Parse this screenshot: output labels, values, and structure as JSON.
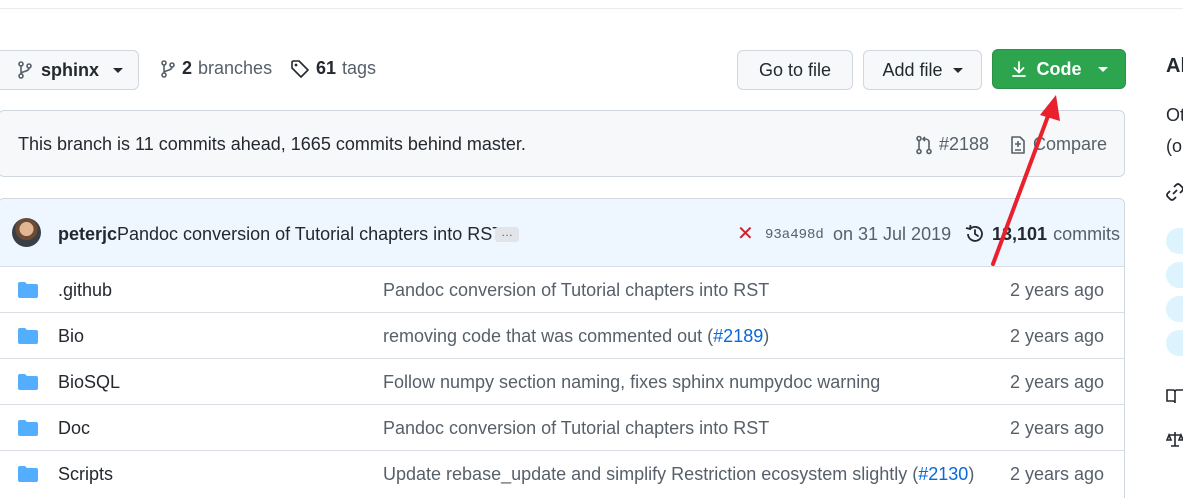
{
  "toolbar": {
    "branch_name": "sphinx",
    "branches_count": "2",
    "branches_label": "branches",
    "tags_count": "61",
    "tags_label": "tags",
    "goto_file_label": "Go to file",
    "add_file_label": "Add file",
    "code_label": "Code"
  },
  "branch_info": {
    "text": "This branch is 11 commits ahead, 1665 commits behind master.",
    "pr_label": "#2188",
    "compare_label": "Compare"
  },
  "latest_commit": {
    "author": "peterjc",
    "message": "Pandoc conversion of Tutorial chapters into RST",
    "ellipsis": "…",
    "status": "✕",
    "sha": "93a498d",
    "date": "on 31 Jul 2019",
    "commit_count": "13,101",
    "commits_label": "commits"
  },
  "files": [
    {
      "name": ".github",
      "message": "Pandoc conversion of Tutorial chapters into RST",
      "link": "",
      "suffix": "",
      "age": "2 years ago"
    },
    {
      "name": "Bio",
      "message": "removing code that was commented out (",
      "link": "#2189",
      "suffix": ")",
      "age": "2 years ago"
    },
    {
      "name": "BioSQL",
      "message": "Follow numpy section naming, fixes sphinx numpydoc warning",
      "link": "",
      "suffix": "",
      "age": "2 years ago"
    },
    {
      "name": "Doc",
      "message": "Pandoc conversion of Tutorial chapters into RST",
      "link": "",
      "suffix": "",
      "age": "2 years ago"
    },
    {
      "name": "Scripts",
      "message": "Update rebase_update and simplify Restriction ecosystem slightly (",
      "link": "#2130",
      "suffix": ")",
      "age": "2 years ago"
    }
  ],
  "sidebar": {
    "title": "Al",
    "line1": "Ot",
    "line2": "(o"
  },
  "colors": {
    "code_button": "#2da44e",
    "arrow": "#e8212d",
    "link": "#0969da",
    "folder": "#54aeff"
  },
  "icons": [
    "branch-icon",
    "git-branch-icon",
    "tag-icon",
    "download-icon",
    "pull-request-icon",
    "compare-icon",
    "history-icon",
    "folder-icon",
    "link-icon",
    "book-icon",
    "scale-icon"
  ]
}
